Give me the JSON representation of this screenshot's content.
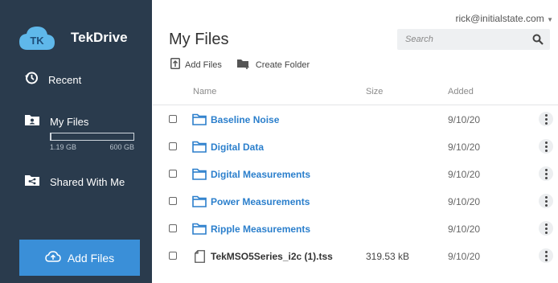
{
  "brand": {
    "name": "TekDrive"
  },
  "sidebar": {
    "recent_label": "Recent",
    "my_files_label": "My Files",
    "shared_label": "Shared With Me",
    "quota_used": "1.19 GB",
    "quota_total": "600 GB",
    "quota_fraction": 0.002,
    "add_files_label": "Add Files"
  },
  "user": {
    "email": "rick@initialstate.com"
  },
  "main": {
    "title": "My Files",
    "search_placeholder": "Search",
    "toolbar": {
      "add_files": "Add Files",
      "create_folder": "Create Folder"
    },
    "columns": {
      "name": "Name",
      "size": "Size",
      "added": "Added"
    },
    "rows": [
      {
        "type": "folder",
        "name": "Baseline Noise",
        "size": "",
        "added": "9/10/20"
      },
      {
        "type": "folder",
        "name": "Digital Data",
        "size": "",
        "added": "9/10/20"
      },
      {
        "type": "folder",
        "name": "Digital Measurements",
        "size": "",
        "added": "9/10/20"
      },
      {
        "type": "folder",
        "name": "Power Measurements",
        "size": "",
        "added": "9/10/20"
      },
      {
        "type": "folder",
        "name": "Ripple Measurements",
        "size": "",
        "added": "9/10/20"
      },
      {
        "type": "file",
        "name": "TekMSO5Series_i2c (1).tss",
        "size": "319.53 kB",
        "added": "9/10/20"
      }
    ]
  },
  "colors": {
    "sidebar": "#2a3b4d",
    "accent": "#3a8fd8",
    "folder": "#2b7fcc"
  }
}
